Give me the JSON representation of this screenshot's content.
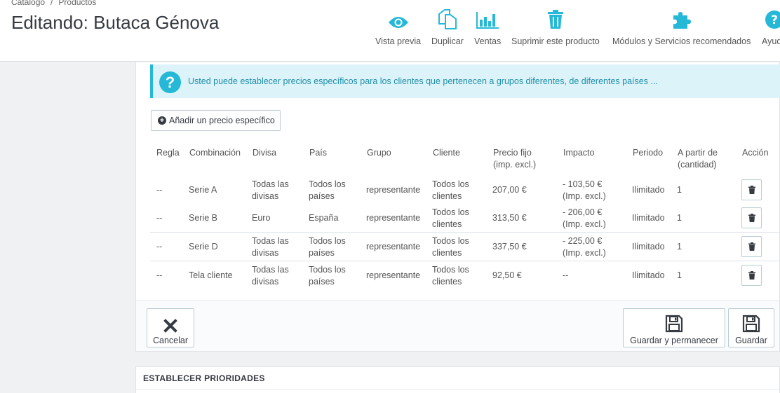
{
  "breadcrumb": {
    "items": [
      "Catálogo",
      "Productos"
    ],
    "separator": "/"
  },
  "page_title": "Editando: Butaca Génova",
  "toolbar": [
    {
      "label": "Vista previa",
      "icon": "eye-icon"
    },
    {
      "label": "Duplicar",
      "icon": "copy-icon"
    },
    {
      "label": "Ventas",
      "icon": "bar-chart-icon"
    },
    {
      "label": "Suprimir este producto",
      "icon": "trash-icon"
    },
    {
      "label": "Módulos y Servicios recomendados",
      "icon": "puzzle-icon"
    },
    {
      "label": "Ayuda",
      "icon": "help-icon"
    }
  ],
  "info_alert": "Usted puede establecer precios específicos para los clientes que pertenecen a grupos diferentes, de diferentes países ...",
  "add_button": "Añadir un precio específico",
  "table": {
    "headers": {
      "regla": "Regla",
      "combinacion": "Combinación",
      "divisa": "Divisa",
      "pais": "País",
      "grupo": "Grupo",
      "cliente": "Cliente",
      "precio_1": "Precio fijo",
      "precio_2": "(imp. excl.)",
      "impacto": "Impacto",
      "periodo": "Periodo",
      "apartir_1": "A partir de",
      "apartir_2": "(cantidad)",
      "accion": "Acción"
    },
    "rows": [
      {
        "regla": "--",
        "combinacion": "Serie A",
        "divisa_1": "Todas las",
        "divisa_2": "divisas",
        "pais_1": "Todos los",
        "pais_2": "países",
        "grupo": "representante",
        "cliente_1": "Todos los",
        "cliente_2": "clientes",
        "precio": "207,00 €",
        "impacto_1": "- 103,50 €",
        "impacto_2": "(Imp. excl.)",
        "periodo": "Ilimitado",
        "cantidad": "1"
      },
      {
        "regla": "--",
        "combinacion": "Serie B",
        "divisa_1": "Euro",
        "divisa_2": "",
        "pais_1": "España",
        "pais_2": "",
        "grupo": "representante",
        "cliente_1": "Todos los",
        "cliente_2": "clientes",
        "precio": "313,50 €",
        "impacto_1": "- 206,00 €",
        "impacto_2": "(Imp. excl.)",
        "periodo": "Ilimitado",
        "cantidad": "1"
      },
      {
        "regla": "--",
        "combinacion": "Serie D",
        "divisa_1": "Todas las",
        "divisa_2": "divisas",
        "pais_1": "Todos los",
        "pais_2": "países",
        "grupo": "representante",
        "cliente_1": "Todos los",
        "cliente_2": "clientes",
        "precio": "337,50 €",
        "impacto_1": "- 225,00 €",
        "impacto_2": "(Imp. excl.)",
        "periodo": "Ilimitado",
        "cantidad": "1"
      },
      {
        "regla": "--",
        "combinacion": "Tela cliente",
        "divisa_1": "Todas las",
        "divisa_2": "divisas",
        "pais_1": "Todos los",
        "pais_2": "países",
        "grupo": "representante",
        "cliente_1": "Todos los",
        "cliente_2": "clientes",
        "precio": "92,50 €",
        "impacto_1": "--",
        "impacto_2": "",
        "periodo": "Ilimitado",
        "cantidad": "1"
      }
    ]
  },
  "footer": {
    "cancel": "Cancelar",
    "save_stay": "Guardar y permanecer",
    "save": "Guardar"
  },
  "priorities_panel": {
    "title": "ESTABLECER PRIORIDADES"
  },
  "colors": {
    "accent": "#25b9d7",
    "alert_bg": "#dcf4f9",
    "text": "#555555"
  }
}
